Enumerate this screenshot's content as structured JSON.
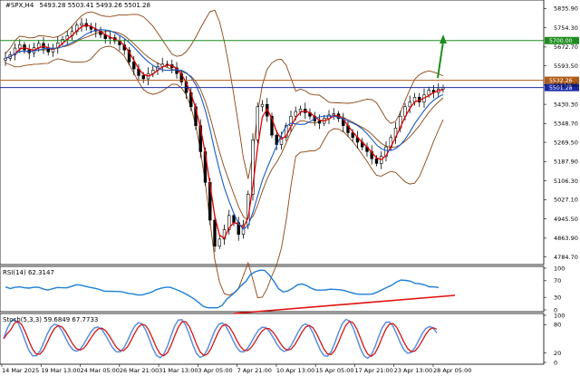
{
  "chart_data": {
    "type": "candlestick",
    "symbol": "#SPX,H4",
    "ohlc_text": "5493.28 5503.41 5493.26 5501.28",
    "y_ticks": [
      "5835.90",
      "5754.30",
      "5672.70",
      "5593.50",
      "5511.90",
      "5430.30",
      "5348.70",
      "5269.50",
      "5187.90",
      "5106.30",
      "5027.10",
      "4945.50",
      "4863.90",
      "4784.70"
    ],
    "ylim": [
      4760,
      5860
    ],
    "x_ticks": [
      "14 Mar 2025",
      "19 Mar 13:00",
      "24 Mar 05:00",
      "26 Mar 21:00",
      "31 Mar 13:00",
      "3 Apr 05:00",
      "7 Apr 21:00",
      "10 Apr 13:00",
      "15 Apr 05:00",
      "17 Apr 21:00",
      "23 Apr 13:00",
      "28 Apr 05:00"
    ],
    "price_series": [
      5625,
      5640,
      5668,
      5682,
      5660,
      5648,
      5670,
      5688,
      5670,
      5652,
      5668,
      5690,
      5705,
      5720,
      5738,
      5765,
      5772,
      5760,
      5748,
      5740,
      5725,
      5708,
      5712,
      5698,
      5682,
      5660,
      5610,
      5580,
      5552,
      5538,
      5560,
      5575,
      5590,
      5600,
      5598,
      5585,
      5560,
      5525,
      5480,
      5420,
      5340,
      5230,
      5100,
      4940,
      4830,
      4860,
      4900,
      4960,
      4930,
      4880,
      4920,
      5050,
      5280,
      5420,
      5430,
      5380,
      5300,
      5260,
      5290,
      5340,
      5380,
      5400,
      5410,
      5395,
      5380,
      5360,
      5350,
      5370,
      5385,
      5390,
      5370,
      5340,
      5310,
      5290,
      5270,
      5250,
      5230,
      5200,
      5180,
      5210,
      5250,
      5290,
      5330,
      5380,
      5420,
      5440,
      5460,
      5440,
      5470,
      5490,
      5480,
      5495,
      5501
    ],
    "horizontal_levels": [
      {
        "label": "5700.00",
        "value": 5700,
        "color": "#1e8c1e"
      },
      {
        "label": "5532.26",
        "value": 5532,
        "color": "#b05a1a"
      },
      {
        "label": "5501.28",
        "value": 5501,
        "color": "#1a2aa8"
      }
    ],
    "rsi": {
      "label": "RSI(14) 62.3147",
      "ticks": [
        "100",
        "70",
        "30",
        "0"
      ],
      "ylim": [
        0,
        100
      ]
    },
    "stoch": {
      "label": "Stoch(5,3,3) 59.6849 67.7733",
      "ticks": [
        "100",
        "80",
        "20",
        "0"
      ],
      "ylim": [
        0,
        100
      ]
    },
    "colors": {
      "candle": "#000000",
      "bollinger": "#8b4513",
      "ma_red": "#e00000",
      "ma_blue": "#1a5cc8",
      "rsi_line": "#1e7fd6",
      "stoch_main": "#5b8fe0",
      "stoch_signal": "#d01818",
      "trend": "#e01010",
      "arrow": "#1e8c1e"
    }
  }
}
